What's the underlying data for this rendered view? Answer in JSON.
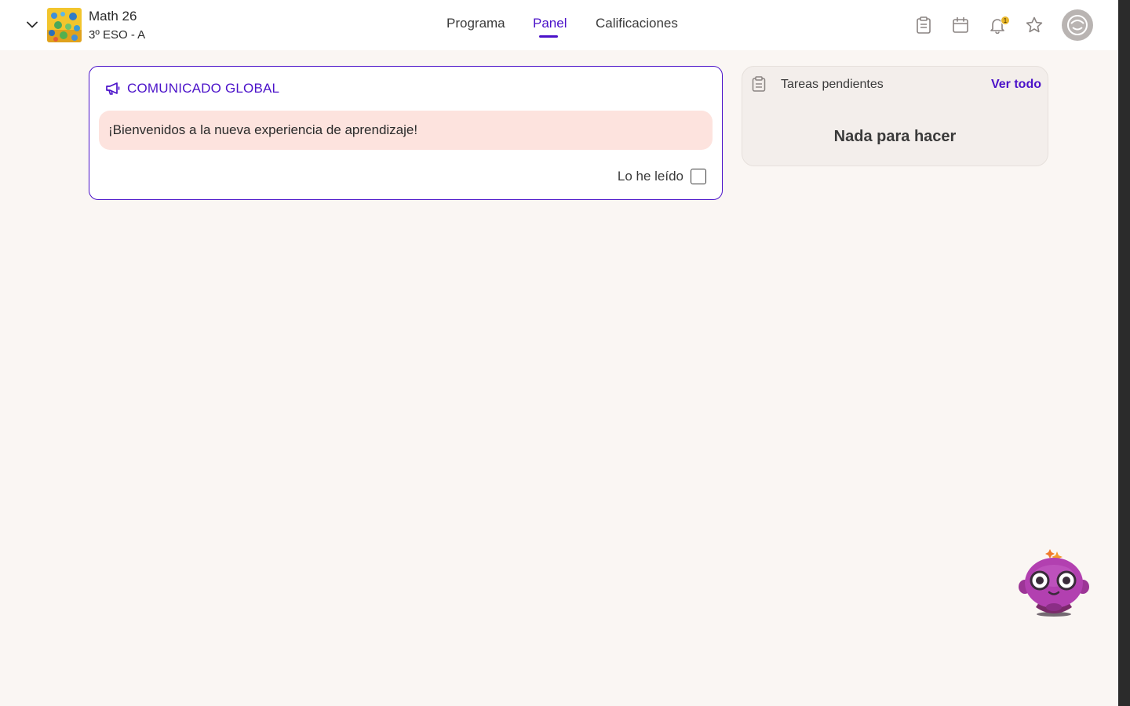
{
  "course": {
    "title": "Math 26",
    "subtitle": "3º ESO - A",
    "thumbnail": "course-thumbnail-image"
  },
  "nav": {
    "tabs": [
      {
        "label": "Programa",
        "active": false
      },
      {
        "label": "Panel",
        "active": true
      },
      {
        "label": "Calificaciones",
        "active": false
      }
    ]
  },
  "header_icons": {
    "tasks": "clipboard-icon",
    "calendar": "calendar-icon",
    "notifications": "bell-icon",
    "notification_count": "1",
    "favorites": "star-icon",
    "profile": "avatar-icon"
  },
  "announcement": {
    "title": "COMUNICADO GLOBAL",
    "message": "¡Bienvenidos a la nueva experiencia de aprendizaje!",
    "read_label": "Lo he leído",
    "read_checked": false
  },
  "tasks": {
    "title": "Tareas pendientes",
    "link": "Ver todo",
    "empty": "Nada para hacer"
  },
  "colors": {
    "accent": "#4b12c9",
    "background": "#faf6f3",
    "message_bg": "#fde3de",
    "card_bg": "#f3eeeb"
  }
}
